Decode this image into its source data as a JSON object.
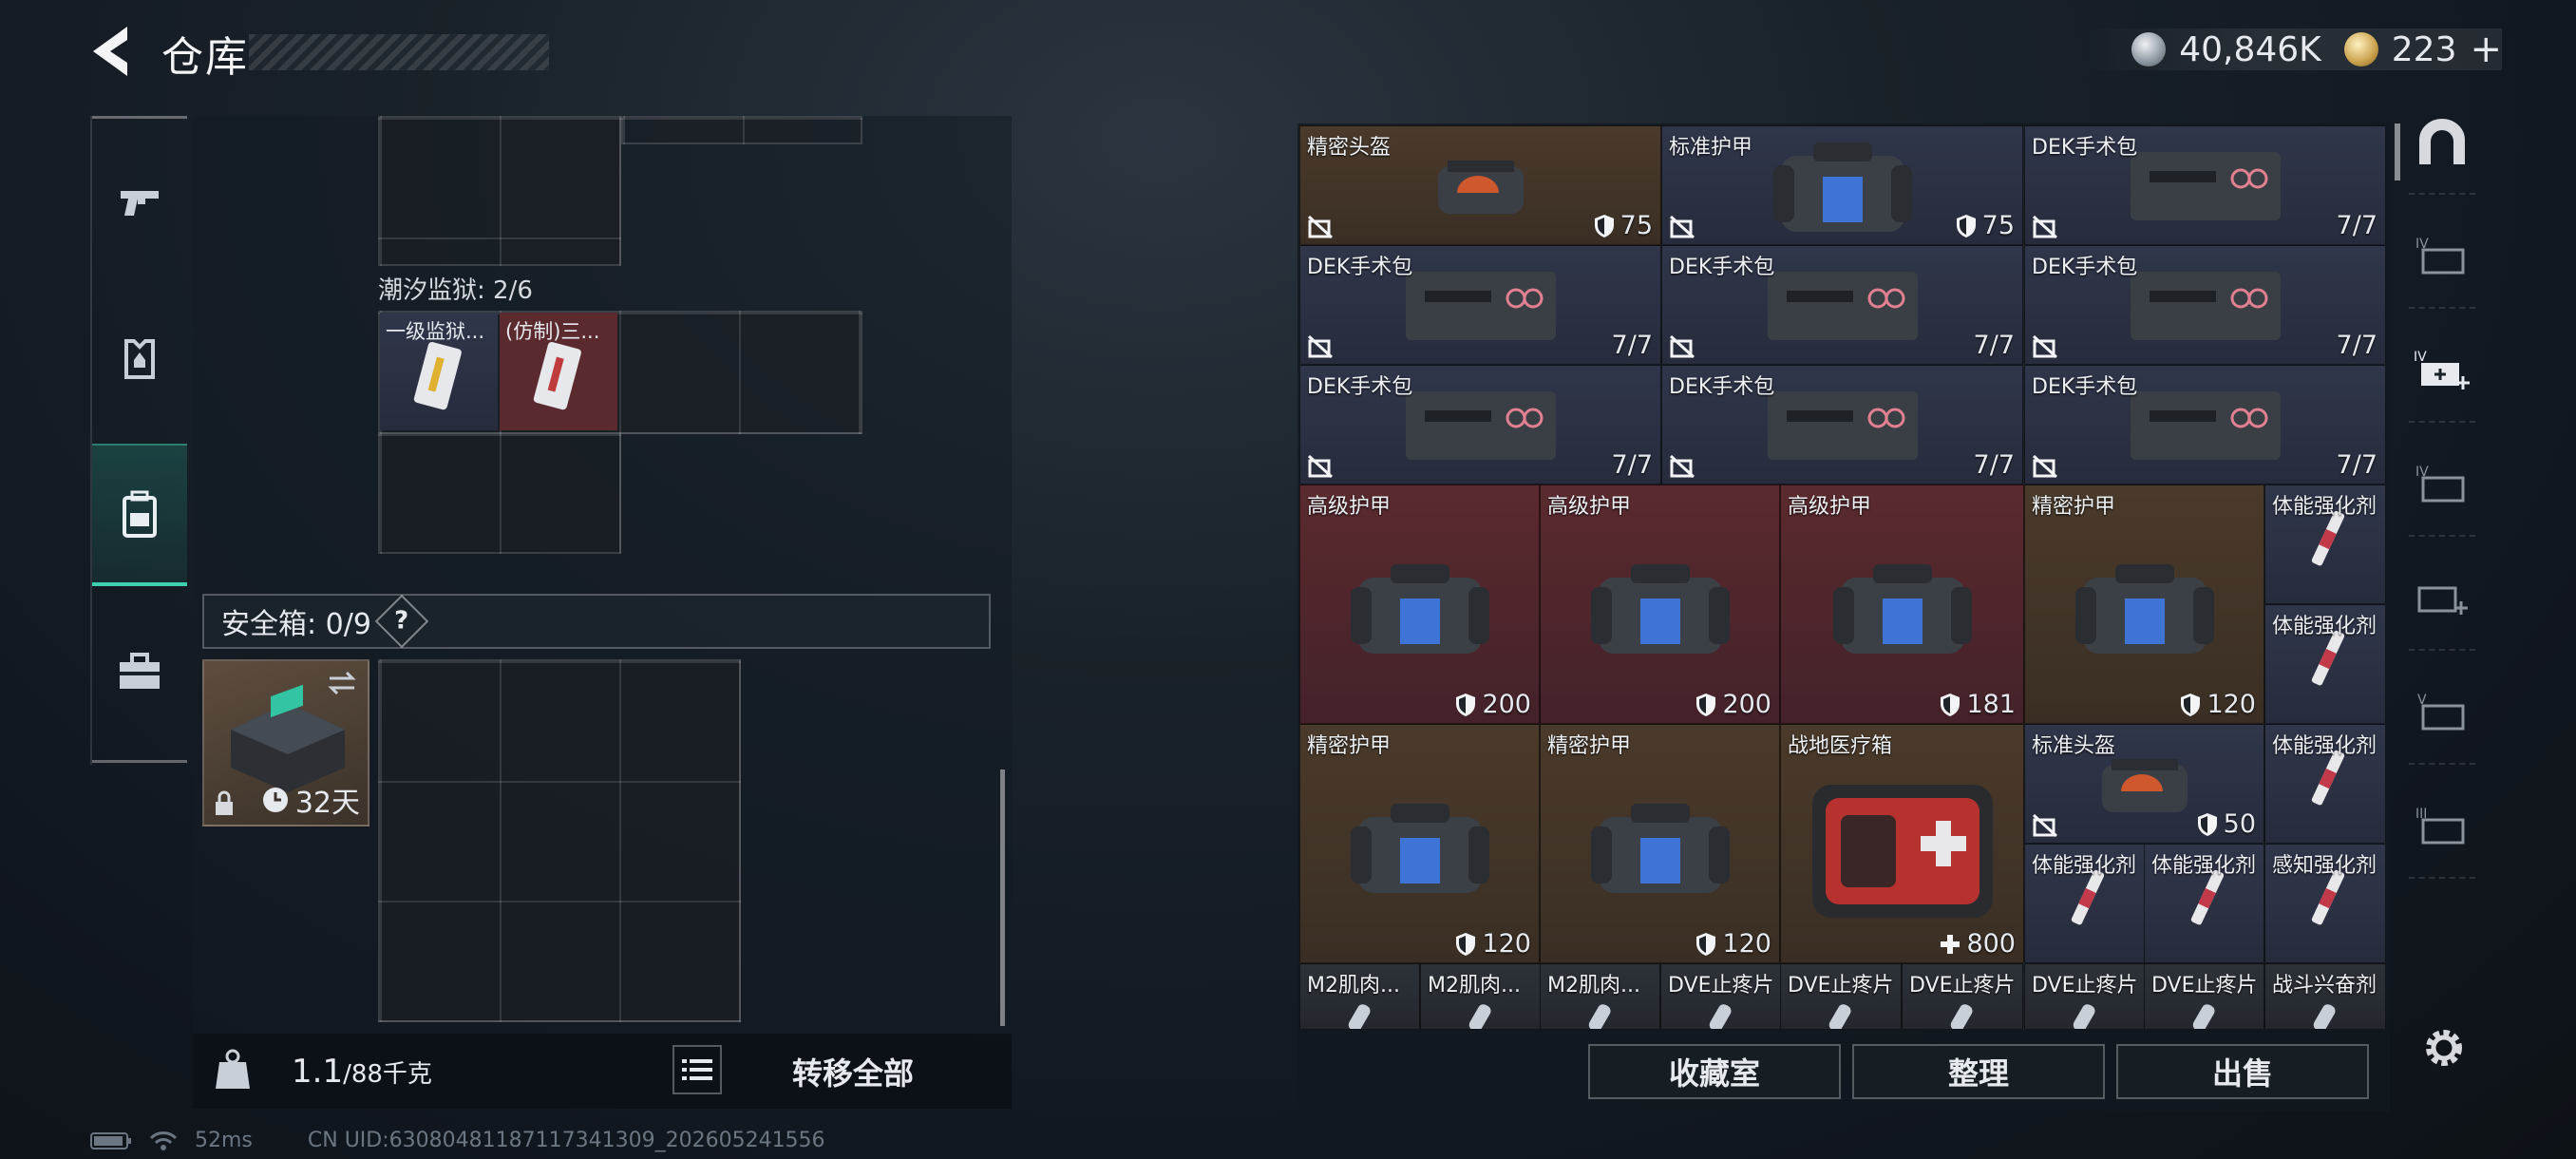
{
  "header": {
    "title": "仓库",
    "currency_silver": "40,846K",
    "currency_gold": "223",
    "plus": "+"
  },
  "left": {
    "tide_label": "潮汐监狱: 2/6",
    "tide_slots": [
      {
        "label": "一级监狱..."
      },
      {
        "label": "(仿制)三..."
      }
    ],
    "safe_label": "安全箱: 0/9",
    "safe_help": "?",
    "safebox_timer": "32天",
    "weight_value": "1.1",
    "weight_max": "/88千克",
    "transfer_all": "转移全部"
  },
  "items": [
    {
      "label": "精密头盔",
      "val": "75",
      "kind": "helmet"
    },
    {
      "label": "标准护甲",
      "val": "75",
      "kind": "armor"
    },
    {
      "label": "DEK手术包",
      "val": "7/7",
      "kind": "kit"
    },
    {
      "label": "DEK手术包",
      "val": "7/7",
      "kind": "kit"
    },
    {
      "label": "DEK手术包",
      "val": "7/7",
      "kind": "kit"
    },
    {
      "label": "DEK手术包",
      "val": "7/7",
      "kind": "kit"
    },
    {
      "label": "DEK手术包",
      "val": "7/7",
      "kind": "kit"
    },
    {
      "label": "DEK手术包",
      "val": "7/7",
      "kind": "kit"
    },
    {
      "label": "DEK手术包",
      "val": "7/7",
      "kind": "kit"
    },
    {
      "label": "高级护甲",
      "val": "200",
      "kind": "armor"
    },
    {
      "label": "高级护甲",
      "val": "200",
      "kind": "armor"
    },
    {
      "label": "高级护甲",
      "val": "181",
      "kind": "armor"
    },
    {
      "label": "精密护甲",
      "val": "120",
      "kind": "armor"
    },
    {
      "label": "体能强化剂",
      "val": "",
      "kind": "syringe"
    },
    {
      "label": "体能强化剂",
      "val": "",
      "kind": "syringe"
    },
    {
      "label": "精密护甲",
      "val": "120",
      "kind": "armor"
    },
    {
      "label": "精密护甲",
      "val": "120",
      "kind": "armor"
    },
    {
      "label": "战地医疗箱",
      "val": "800",
      "kind": "medbox"
    },
    {
      "label": "标准头盔",
      "val": "50",
      "kind": "helmet"
    },
    {
      "label": "体能强化剂",
      "val": "",
      "kind": "syringe"
    },
    {
      "label": "体能强化剂",
      "val": "",
      "kind": "syringe"
    },
    {
      "label": "体能强化剂",
      "val": "",
      "kind": "syringe"
    },
    {
      "label": "感知强化剂",
      "val": "",
      "kind": "syringe"
    },
    {
      "label": "M2肌肉...",
      "val": "",
      "kind": "pill"
    },
    {
      "label": "M2肌肉...",
      "val": "",
      "kind": "pill"
    },
    {
      "label": "M2肌肉...",
      "val": "",
      "kind": "pill"
    },
    {
      "label": "DVE止疼片",
      "val": "",
      "kind": "pill"
    },
    {
      "label": "DVE止疼片",
      "val": "",
      "kind": "pill"
    },
    {
      "label": "DVE止疼片",
      "val": "",
      "kind": "pill"
    },
    {
      "label": "DVE止疼片",
      "val": "",
      "kind": "pill"
    },
    {
      "label": "DVE止疼片",
      "val": "",
      "kind": "pill"
    },
    {
      "label": "战斗兴奋剂",
      "val": "",
      "kind": "pill"
    }
  ],
  "buttons": {
    "collection": "收藏室",
    "sort": "整理",
    "sell": "出售"
  },
  "status": {
    "ping": "52ms",
    "uid": "CN UID:63080481187117341309_202605241556"
  },
  "colors": {
    "accent": "#3fd0b2",
    "rare_red": "#5a2a2e",
    "epic_brown": "#4a3a2b",
    "blue": "#30364a"
  },
  "icons": [
    "back-arrow-icon",
    "gun-icon",
    "armor-icon",
    "backpack-icon",
    "toolbox-icon",
    "helmet-icon",
    "armor-bag-icon",
    "first-aid-kit-icon",
    "syringe-icon",
    "shield-icon",
    "broken-icon",
    "plus-icon",
    "lock-icon",
    "clock-icon",
    "weight-icon",
    "list-icon",
    "gear-icon",
    "battery-icon",
    "wifi-icon"
  ]
}
